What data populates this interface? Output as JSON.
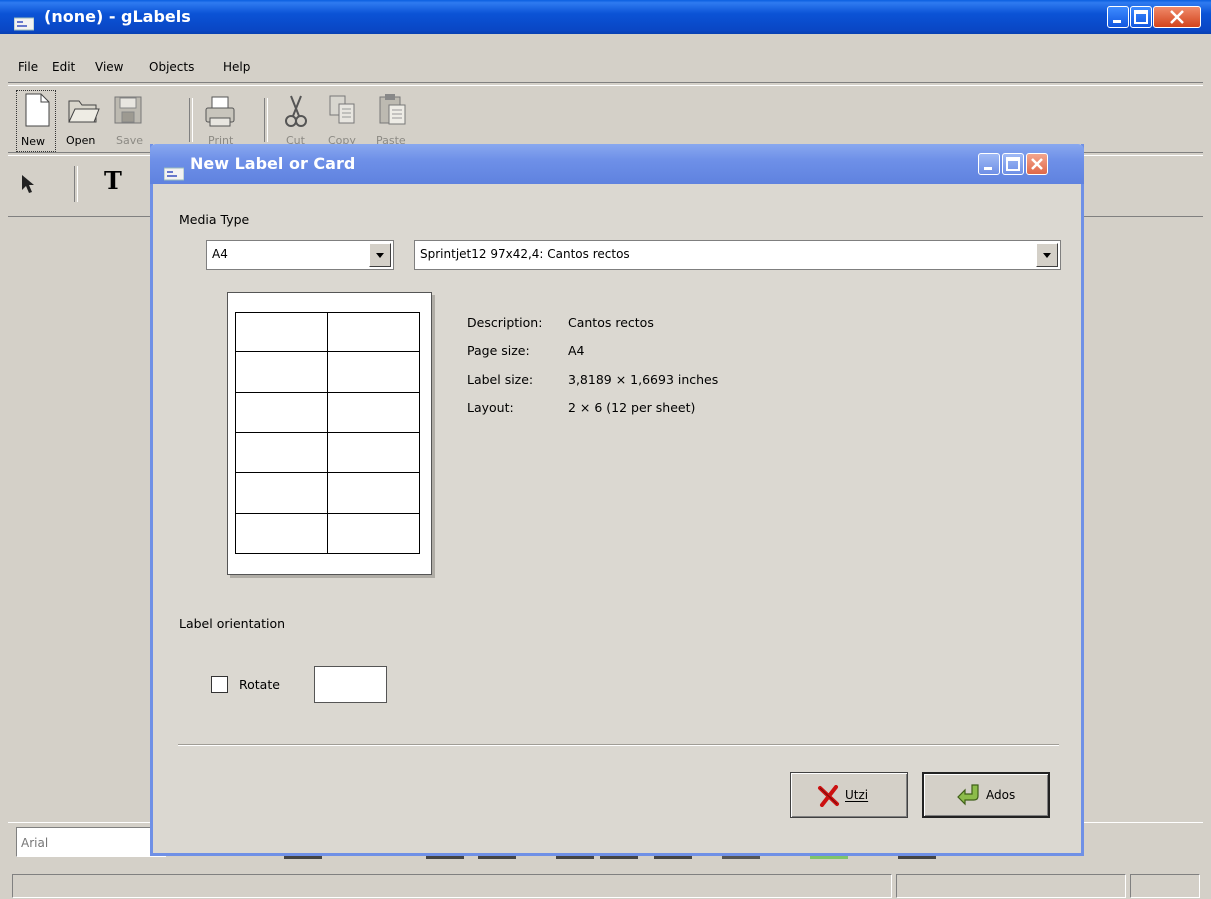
{
  "window": {
    "title": "(none) - gLabels"
  },
  "menu": {
    "items": [
      "File",
      "Edit",
      "View",
      "Objects",
      "Help"
    ]
  },
  "toolbar": {
    "new_label": "New",
    "open_label": "Open",
    "save_label": "Save",
    "print_label": "Print",
    "cut_label": "Cut",
    "copy_label": "Copy",
    "paste_label": "Paste"
  },
  "drawing_tools": {
    "text_tool": "T"
  },
  "font_bar": {
    "font_name": "Arial"
  },
  "dialog": {
    "title": "New Label or Card",
    "media_type_heading": "Media Type",
    "page_size_combo": "A4",
    "template_combo": "Sprintjet12 97x42,4: Cantos rectos",
    "details": {
      "description_label": "Description:",
      "description_value": "Cantos rectos",
      "page_size_label": "Page size:",
      "page_size_value": "A4",
      "label_size_label": "Label size:",
      "label_size_value": "3,8189 × 1,6693 inches",
      "layout_label": "Layout:",
      "layout_value": "2 × 6  (12 per sheet)"
    },
    "preview": {
      "columns": 2,
      "rows": 6
    },
    "orientation_heading": "Label orientation",
    "rotate_label": "Rotate",
    "rotate_checked": false,
    "cancel_button": "Utzi",
    "ok_button": "Ados"
  },
  "colors": {
    "titlebar_active": "#0a4fd0",
    "titlebar_dialog": "#6e90e8",
    "window_face": "#d4d0c8",
    "cancel_icon": "#cc1111",
    "ok_icon": "#5b8a2a"
  }
}
